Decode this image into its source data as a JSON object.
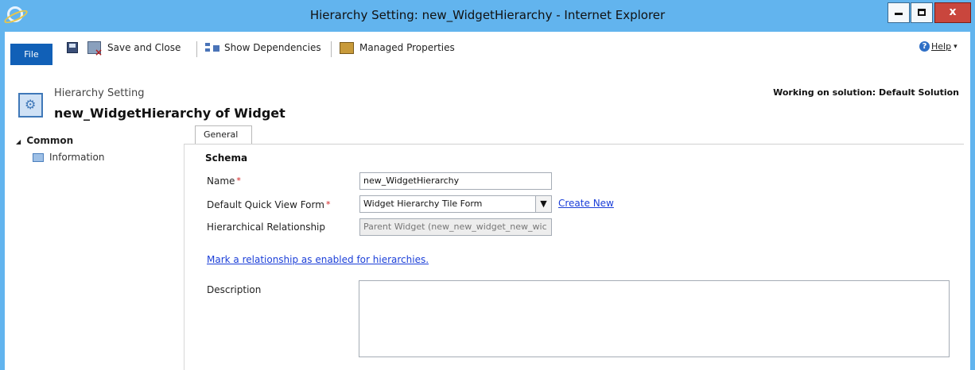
{
  "window": {
    "title": "Hierarchy Setting: new_WidgetHierarchy - Internet Explorer"
  },
  "commandbar": {
    "file_label": "File",
    "save_close_label": "Save and Close",
    "show_dependencies_label": "Show Dependencies",
    "managed_properties_label": "Managed Properties",
    "help_label": "Help",
    "help_caret": "▾"
  },
  "header": {
    "entity_type": "Hierarchy Setting",
    "entity_name": "new_WidgetHierarchy of Widget",
    "solution_text": "Working on solution: Default Solution"
  },
  "leftnav": {
    "section_label": "Common",
    "section_toggle": "◢",
    "items": [
      {
        "label": "Information"
      }
    ]
  },
  "tabs": [
    {
      "label": "General"
    }
  ],
  "form": {
    "section_title": "Schema",
    "name_label": "Name",
    "name_value": "new_WidgetHierarchy",
    "qvf_label": "Default Quick View Form",
    "qvf_value": "Widget Hierarchy Tile Form",
    "qvf_arrow": "▼",
    "create_new_label": "Create New",
    "hier_rel_label": "Hierarchical Relationship",
    "hier_rel_value": "Parent Widget (new_new_widget_new_wic",
    "hier_link_label": "Mark a relationship as enabled for hierarchies.",
    "description_label": "Description",
    "required_marker": "*"
  },
  "colors": {
    "titlebar": "#62b4ee",
    "file_button": "#1160b7",
    "link": "#1b3fd8",
    "required": "#d21f1f",
    "close_button": "#c9463d"
  }
}
